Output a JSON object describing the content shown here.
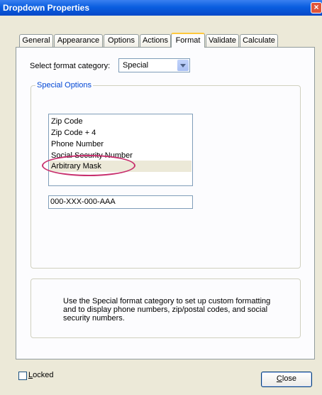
{
  "window": {
    "title": "Dropdown Properties",
    "close_glyph": "×"
  },
  "tabs": [
    {
      "label": "General"
    },
    {
      "label": "Appearance"
    },
    {
      "label": "Options"
    },
    {
      "label": "Actions"
    },
    {
      "label": "Format",
      "active": true
    },
    {
      "label": "Validate"
    },
    {
      "label": "Calculate"
    }
  ],
  "format": {
    "category_label_pre": "Select ",
    "category_label_accel": "f",
    "category_label_post": "ormat category:",
    "category_value": "Special"
  },
  "special_options": {
    "group_title": "Special Options",
    "items": [
      {
        "label": "Zip Code"
      },
      {
        "label": "Zip Code + 4"
      },
      {
        "label": "Phone Number"
      },
      {
        "label": "Social Security Number"
      },
      {
        "label": "Arbitrary Mask",
        "selected": true
      }
    ],
    "mask_value": "000-XXX-000-AAA"
  },
  "info": {
    "text": "Use the Special format category to set up custom formatting and to display phone numbers, zip/postal codes, and social security numbers."
  },
  "footer": {
    "locked_accel": "L",
    "locked_rest": "ocked",
    "close_accel": "C",
    "close_rest": "lose"
  },
  "colors": {
    "titlebar": "#0a5ee0",
    "dialog_bg": "#ece9d8",
    "group_title": "#0046d5",
    "highlight_ellipse": "#c8306e",
    "active_tab_accent": "#ffc83c"
  }
}
